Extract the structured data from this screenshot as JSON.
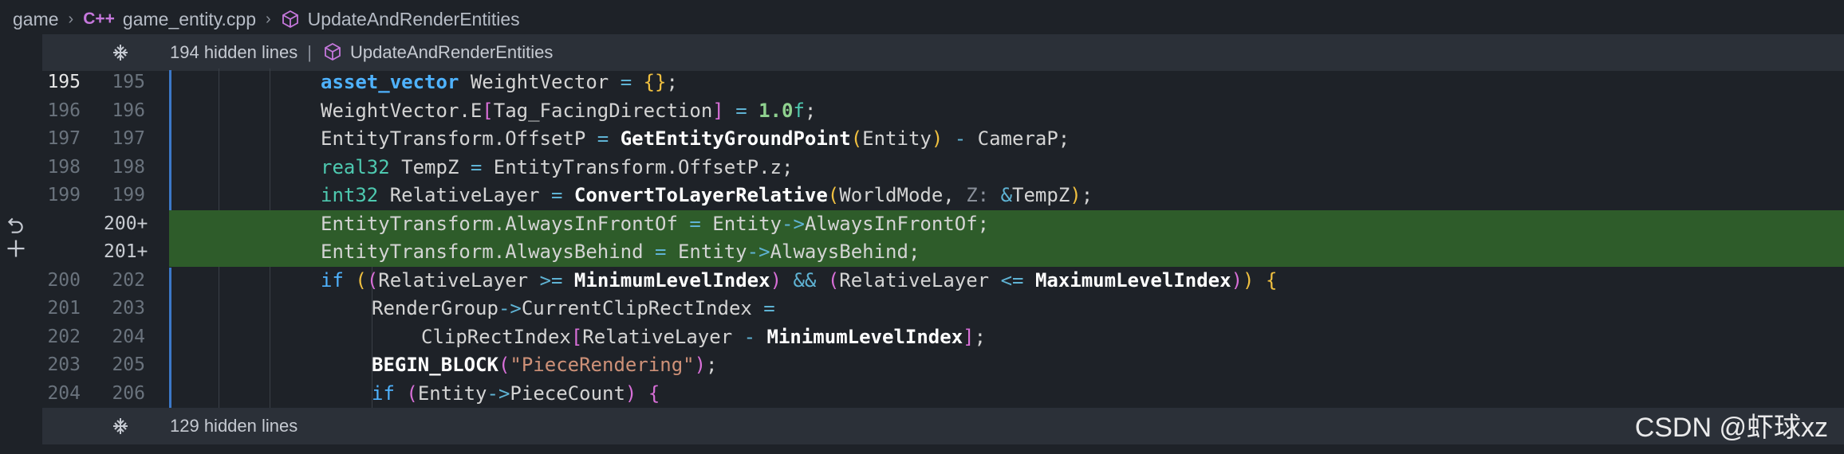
{
  "breadcrumb": {
    "root": "game",
    "file_icon": "C++",
    "file": "game_entity.cpp",
    "symbol": "UpdateAndRenderEntities"
  },
  "hidden_top": {
    "count_text": "194 hidden lines",
    "symbol": "UpdateAndRenderEntities"
  },
  "hidden_bottom": {
    "count_text": "129 hidden lines"
  },
  "lines": [
    {
      "left": "195",
      "right": "195",
      "current": true
    },
    {
      "left": "196",
      "right": "196"
    },
    {
      "left": "197",
      "right": "197"
    },
    {
      "left": "198",
      "right": "198"
    },
    {
      "left": "199",
      "right": "199"
    },
    {
      "left": "",
      "right": "200+",
      "added": true
    },
    {
      "left": "",
      "right": "201+",
      "added": true
    },
    {
      "left": "200",
      "right": "202"
    },
    {
      "left": "201",
      "right": "203"
    },
    {
      "left": "202",
      "right": "204"
    },
    {
      "left": "203",
      "right": "205"
    },
    {
      "left": "204",
      "right": "206"
    }
  ],
  "watermark": "CSDN @虾球xz",
  "colors": {
    "background": "#1e2228",
    "added_line": "#2e5c2a",
    "hidden_bar": "#2b3038",
    "modified_gutter": "#3c78c8"
  }
}
